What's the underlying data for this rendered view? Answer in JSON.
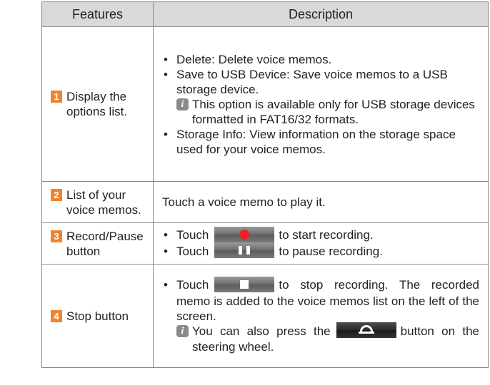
{
  "table": {
    "headers": [
      "Features",
      "Description"
    ],
    "rows": [
      {
        "num": "1",
        "feature": "Display the options list.",
        "bullets": [
          "Delete: Delete voice memos.",
          "Save to USB Device: Save voice memos to a USB storage device."
        ],
        "note": "This option is available only for USB storage devices formatted in FAT16/32 formats.",
        "bullet_last": "Storage Info: View information on the storage space used for your voice memos."
      },
      {
        "num": "2",
        "feature": "List of your voice memos.",
        "description": "Touch a voice memo to play it."
      },
      {
        "num": "3",
        "feature": "Record/Pause button",
        "line1_pre": "Touch",
        "line1_post": "to start recording.",
        "line2_pre": "Touch",
        "line2_post": "to pause recording."
      },
      {
        "num": "4",
        "feature": "Stop button",
        "pre": "Touch",
        "post": "to stop recording. The recorded memo is added to the voice memos list on the left of the screen.",
        "note_pre": "You can also press the",
        "note_post": "button on the steering wheel."
      }
    ]
  },
  "icons": {
    "number_badge": "orange-number-badge",
    "info": "info-icon",
    "record": "record-icon",
    "pause": "pause-icon",
    "stop": "stop-icon",
    "hang_up": "hang-up-icon"
  },
  "colors": {
    "badge": "#f0842e",
    "header_bg": "#d9d9da",
    "record_dot": "#e8232a"
  }
}
